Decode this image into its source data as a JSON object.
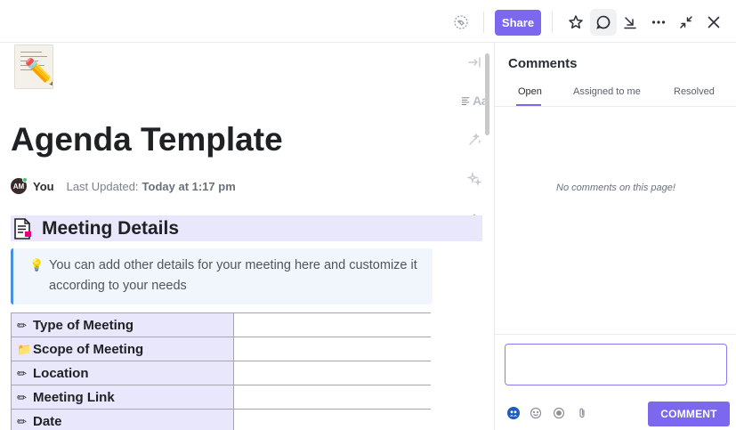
{
  "toolbar": {
    "share_label": "Share"
  },
  "document": {
    "title": "Agenda Template",
    "meta": {
      "avatar_initials": "AM",
      "author": "You",
      "last_updated_label": "Last Updated:",
      "last_updated_value": "Today at 1:17 pm"
    },
    "side_tools": {
      "font_label": "Aa"
    },
    "section_title": "Meeting Details",
    "callout_text": "You can add other details for your meeting here and customize it according to your needs",
    "details_table": [
      {
        "icon": "pencil-icon",
        "label": "Type of Meeting",
        "value": ""
      },
      {
        "icon": "folder-icon",
        "label": "Scope of Meeting",
        "value": ""
      },
      {
        "icon": "pencil-icon",
        "label": "Location",
        "value": ""
      },
      {
        "icon": "pencil-icon",
        "label": "Meeting Link",
        "value": ""
      },
      {
        "icon": "pencil-icon",
        "label": "Date",
        "value": ""
      }
    ]
  },
  "comments": {
    "title": "Comments",
    "tabs": [
      {
        "label": "Open",
        "active": true
      },
      {
        "label": "Assigned to me",
        "active": false
      },
      {
        "label": "Resolved",
        "active": false
      }
    ],
    "empty_message": "No comments on this page!",
    "input_value": "",
    "submit_label": "COMMENT"
  },
  "colors": {
    "accent": "#7b68ee",
    "section_bg": "#e8e7fb",
    "callout_bg": "#f1f6fc",
    "callout_border": "#4a90e2"
  }
}
